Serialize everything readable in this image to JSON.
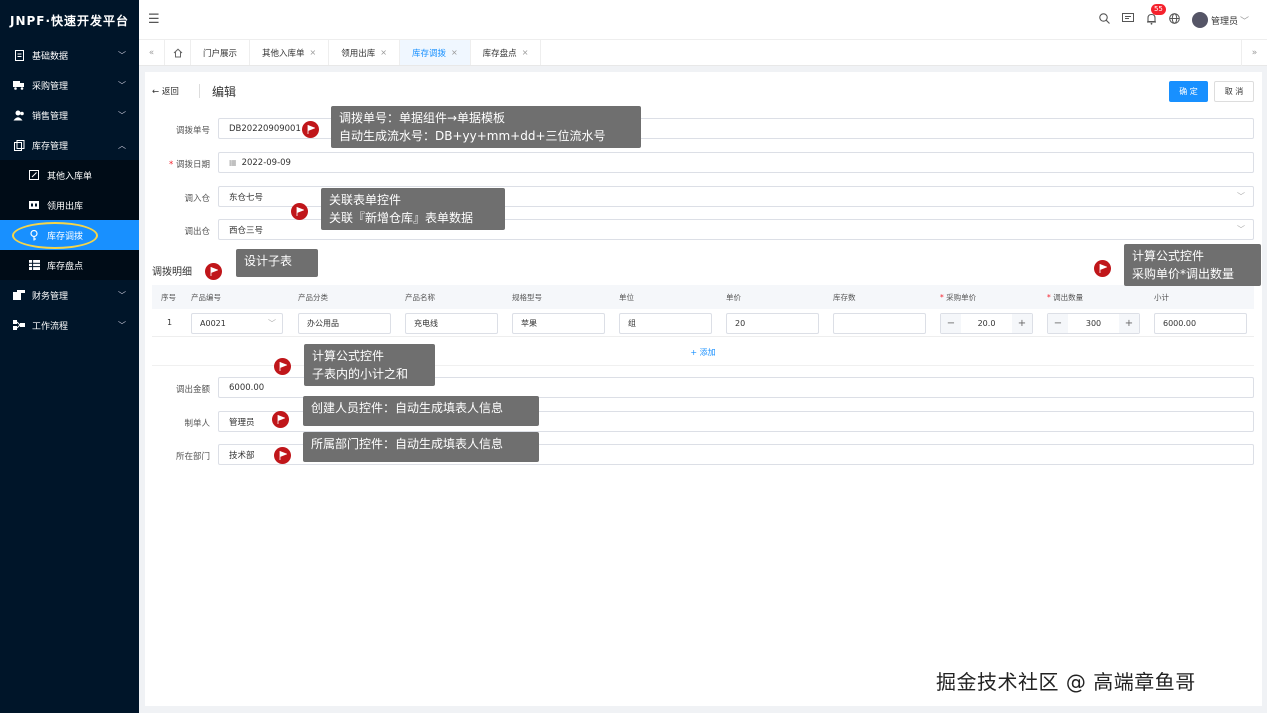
{
  "app": {
    "logo": "JNPF·快速开发平台"
  },
  "sidebar": {
    "items": [
      {
        "label": "基础数据",
        "icon": "document-icon"
      },
      {
        "label": "采购管理",
        "icon": "truck-icon"
      },
      {
        "label": "销售管理",
        "icon": "users-icon"
      },
      {
        "label": "库存管理",
        "icon": "copy-icon"
      },
      {
        "label": "财务管理",
        "icon": "finance-icon"
      },
      {
        "label": "工作流程",
        "icon": "flow-icon"
      }
    ],
    "sub_items": [
      {
        "label": "其他入库单",
        "icon": "edit-icon"
      },
      {
        "label": "领用出库",
        "icon": "outbound-icon"
      },
      {
        "label": "库存调拨",
        "icon": "transfer-icon"
      },
      {
        "label": "库存盘点",
        "icon": "table-icon"
      }
    ]
  },
  "topbar": {
    "badge": "55",
    "user": "管理员"
  },
  "tabs": [
    {
      "label": "门户展示",
      "closable": false
    },
    {
      "label": "其他入库单",
      "closable": true
    },
    {
      "label": "领用出库",
      "closable": true
    },
    {
      "label": "库存调拨",
      "closable": true
    },
    {
      "label": "库存盘点",
      "closable": true
    }
  ],
  "page": {
    "back": "返回",
    "title": "编辑",
    "confirm": "确 定",
    "cancel": "取 消"
  },
  "form": {
    "no_label": "调拨单号",
    "no_value": "DB20220909001",
    "date_label": "调拨日期",
    "date_value": "2022-09-09",
    "in_label": "调入仓",
    "in_value": "东仓七号",
    "out_label": "调出仓",
    "out_value": "西仓三号",
    "detail_title": "调拨明细",
    "amount_label": "调出金额",
    "amount_value": "6000.00",
    "maker_label": "制单人",
    "maker_value": "管理员",
    "dept_label": "所在部门",
    "dept_value": "技术部"
  },
  "table": {
    "headers": [
      "序号",
      "产品编号",
      "产品分类",
      "产品名称",
      "规格型号",
      "单位",
      "单价",
      "库存数",
      "采购单价",
      "调出数量",
      "小计"
    ],
    "row": {
      "index": "1",
      "code": "A0021",
      "category": "办公用品",
      "name": "充电线",
      "spec": "苹果",
      "unit": "组",
      "price": "20",
      "stock": "",
      "purchase_price": "20.0",
      "qty": "300",
      "subtotal": "6000.00"
    },
    "add": "+ 添加"
  },
  "tips": {
    "t1_line1": "调拨单号：单据组件→单据模板",
    "t1_line2": "自动生成流水号：DB+yy+mm+dd+三位流水号",
    "t2_line1": "关联表单控件",
    "t2_line2": "关联『新增仓库』表单数据",
    "t3": "设计子表",
    "t4_line1": "计算公式控件",
    "t4_line2": "采购单价*调出数量",
    "t5_line1": "计算公式控件",
    "t5_line2": "子表内的小计之和",
    "t6": "创建人员控件：自动生成填表人信息",
    "t7": "所属部门控件：自动生成填表人信息"
  },
  "watermark": "掘金技术社区 @ 高端章鱼哥"
}
